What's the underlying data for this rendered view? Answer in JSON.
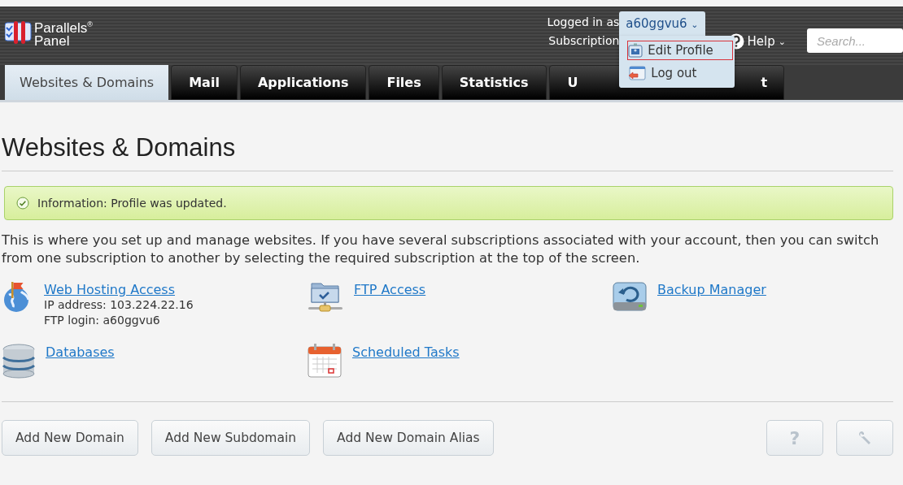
{
  "logo": {
    "line1": "Parallels",
    "mark": "®",
    "line2": "Panel"
  },
  "account": {
    "logged_in_label": "Logged in as",
    "user": "a60ggvu6",
    "caret": "⌄",
    "subscription_label": "Subscription"
  },
  "user_menu": {
    "expanded": true,
    "items": [
      {
        "label": "Edit Profile",
        "kind": "profile",
        "selected": true
      },
      {
        "label": "Log out",
        "kind": "logout",
        "selected": false
      }
    ]
  },
  "help": {
    "label": "Help",
    "caret": "⌄"
  },
  "search": {
    "placeholder": "Search..."
  },
  "tabs": [
    {
      "label": "Websites & Domains",
      "selected": true
    },
    {
      "label": "Mail",
      "selected": false
    },
    {
      "label": "Applications",
      "selected": false
    },
    {
      "label": "Files",
      "selected": false
    },
    {
      "label": "Statistics",
      "selected": false
    },
    {
      "label": "U",
      "label_end": "t",
      "selected": false
    }
  ],
  "page_title": "Websites & Domains",
  "message": {
    "label": "Information:",
    "text": "Profile was updated."
  },
  "description": "This is where you set up and manage websites. If you have several subscriptions associated with your account, then you can switch from one subscription to another by selecting the required subscription at the top of the screen.",
  "tools": [
    {
      "kind": "globe",
      "label": "Web Hosting Access",
      "details": [
        "IP address: 103.224.22.16",
        "FTP login: a60ggvu6"
      ]
    },
    {
      "kind": "ftp",
      "label": "FTP Access"
    },
    {
      "kind": "backup",
      "label": "Backup Manager"
    },
    {
      "kind": "database",
      "label": "Databases"
    },
    {
      "kind": "calendar",
      "label": "Scheduled Tasks"
    }
  ],
  "buttons": [
    "Add New Domain",
    "Add New Subdomain",
    "Add New Domain Alias"
  ],
  "icon_buttons": [
    {
      "kind": "help",
      "label": "?"
    },
    {
      "kind": "tools"
    }
  ]
}
